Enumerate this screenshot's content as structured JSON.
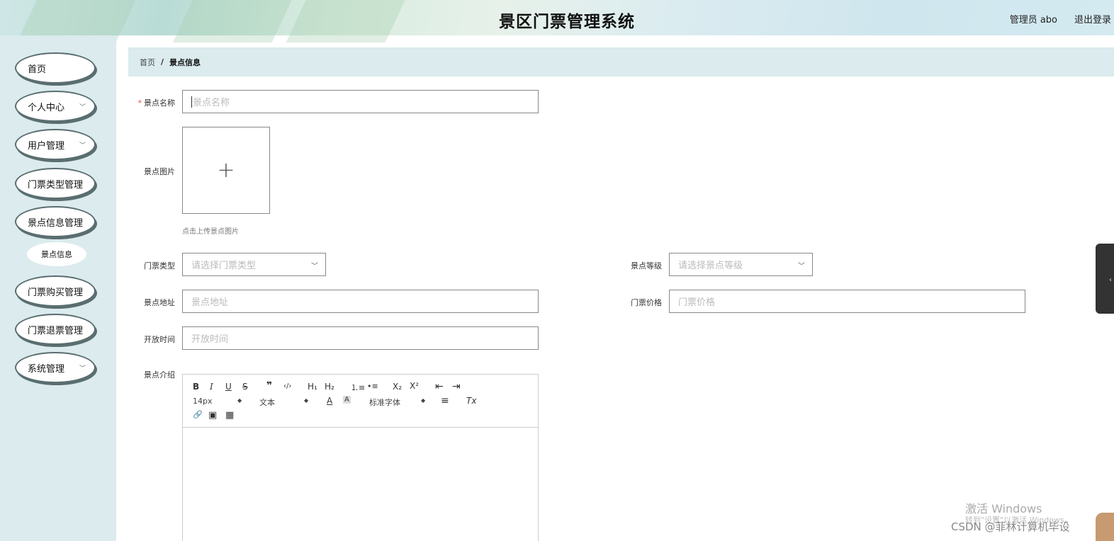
{
  "header": {
    "title": "景区门票管理系统",
    "user": "管理员 abo",
    "logout": "退出登录"
  },
  "sidebar": {
    "items": [
      {
        "label": "首页"
      },
      {
        "label": "个人中心"
      },
      {
        "label": "用户管理"
      },
      {
        "label": "门票类型管理"
      },
      {
        "label": "景点信息管理"
      },
      {
        "label": "景点信息"
      },
      {
        "label": "门票购买管理"
      },
      {
        "label": "门票退票管理"
      },
      {
        "label": "系统管理"
      }
    ]
  },
  "breadcrumb": {
    "home": "首页",
    "separator": "/",
    "current": "景点信息"
  },
  "form": {
    "name": {
      "label": "景点名称",
      "placeholder": "景点名称",
      "required_mark": "*"
    },
    "image": {
      "label": "景点图片",
      "upload_symbol": "+",
      "hint": "点击上传景点图片"
    },
    "ticket_type": {
      "label": "门票类型",
      "placeholder": "请选择门票类型"
    },
    "level": {
      "label": "景点等级",
      "placeholder": "请选择景点等级"
    },
    "address": {
      "label": "景点地址",
      "placeholder": "景点地址"
    },
    "price": {
      "label": "门票价格",
      "placeholder": "门票价格"
    },
    "open_time": {
      "label": "开放时间",
      "placeholder": "开放时间"
    },
    "intro": {
      "label": "景点介绍"
    }
  },
  "editor": {
    "font_size": "14px",
    "text_style": "文本",
    "font_family": "标准字体",
    "buttons": {
      "bold": "B",
      "italic": "I",
      "underline": "U",
      "strike": "S",
      "quote": "❞",
      "code": "‹/›",
      "h1": "H₁",
      "h2": "H₂",
      "ol": "⒈≡",
      "ul": "•≡",
      "sub": "X₂",
      "sup": "X²",
      "outdent": "⇤",
      "indent": "⇥",
      "color": "A",
      "bg": "A",
      "align": "≡",
      "clean": "Tx",
      "link": "🔗",
      "image": "▣",
      "video": "▦"
    }
  },
  "watermark": {
    "activate": "激活 Windows",
    "activate_sub": "转到\"设置\"以激活 Windows。",
    "csdn": "CSDN @菲林计算机毕设"
  }
}
